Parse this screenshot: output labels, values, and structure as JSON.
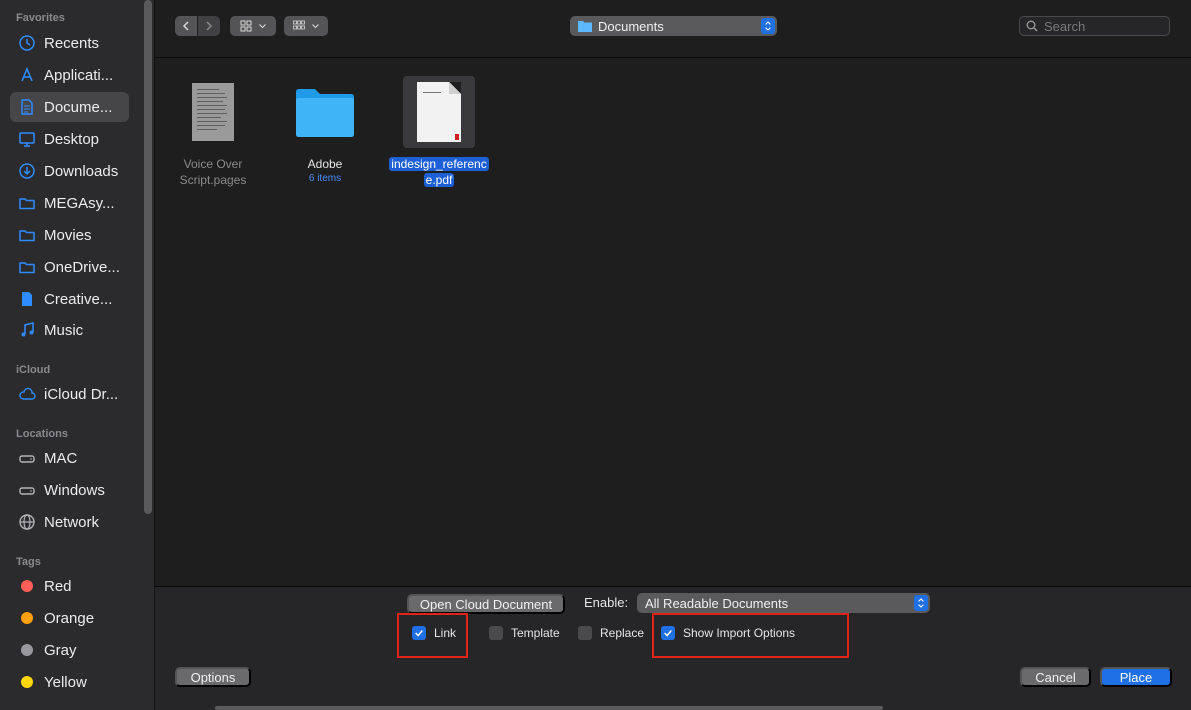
{
  "sidebar": {
    "favorites_heading": "Favorites",
    "favorites": [
      {
        "label": "Recents",
        "icon": "clock-icon"
      },
      {
        "label": "Applicati...",
        "icon": "applications-icon"
      },
      {
        "label": "Docume...",
        "icon": "document-icon",
        "active": true
      },
      {
        "label": "Desktop",
        "icon": "desktop-icon"
      },
      {
        "label": "Downloads",
        "icon": "download-icon"
      },
      {
        "label": "MEGAsy...",
        "icon": "folder-icon"
      },
      {
        "label": "Movies",
        "icon": "folder-icon"
      },
      {
        "label": "OneDrive...",
        "icon": "folder-icon"
      },
      {
        "label": "Creative...",
        "icon": "file-icon"
      },
      {
        "label": "Music",
        "icon": "music-icon"
      }
    ],
    "icloud_heading": "iCloud",
    "icloud": [
      {
        "label": "iCloud Dr...",
        "icon": "cloud-icon"
      }
    ],
    "locations_heading": "Locations",
    "locations": [
      {
        "label": "MAC",
        "icon": "disk-icon"
      },
      {
        "label": "Windows",
        "icon": "disk-icon"
      },
      {
        "label": "Network",
        "icon": "globe-icon"
      }
    ],
    "tags_heading": "Tags",
    "tags": [
      {
        "label": "Red",
        "color": "#ff5f57"
      },
      {
        "label": "Orange",
        "color": "#ff9f0a"
      },
      {
        "label": "Gray",
        "color": "#98989d"
      },
      {
        "label": "Yellow",
        "color": "#ffd60a"
      }
    ]
  },
  "toolbar": {
    "location": "Documents",
    "search_placeholder": "Search"
  },
  "files": [
    {
      "name": "Voice Over Script.pages",
      "name_line1": "Voice Over",
      "name_line2": "Script.pages"
    },
    {
      "name": "Adobe",
      "sub": "6 items"
    },
    {
      "name_line1": "indesign_referenc",
      "name_line2": "e.pdf"
    }
  ],
  "options": {
    "open_cloud_label": "Open Cloud Document",
    "enable_label": "Enable:",
    "enable_value": "All Readable Documents",
    "link_label": "Link",
    "link_checked": true,
    "template_label": "Template",
    "template_checked": false,
    "replace_label": "Replace",
    "replace_checked": false,
    "show_import_label": "Show Import Options",
    "show_import_checked": true,
    "options_label": "Options",
    "cancel_label": "Cancel",
    "place_label": "Place"
  },
  "colors": {
    "accent": "#1f6fe5",
    "highlight_box": "#e2231a"
  }
}
